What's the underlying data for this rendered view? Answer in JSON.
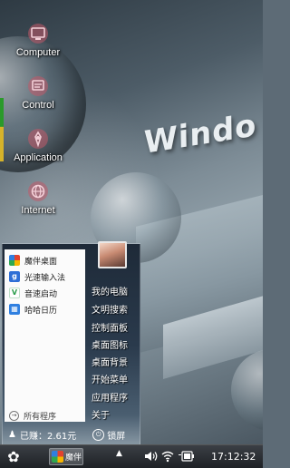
{
  "desktop": {
    "icons": [
      {
        "label": "Computer",
        "icon": "computer-icon"
      },
      {
        "label": "Control",
        "icon": "control-panel-icon"
      },
      {
        "label": "Application",
        "icon": "application-icon"
      },
      {
        "label": "Internet",
        "icon": "internet-icon"
      }
    ],
    "wallpaper_text": "Windo"
  },
  "start_menu": {
    "apps": [
      {
        "label": "魔伴桌面",
        "icon": "mobanzhuomian-app-icon",
        "color": "#3a8ee6"
      },
      {
        "label": "光速输入法",
        "icon": "guangsu-input-app-icon",
        "color": "#2e6fd6"
      },
      {
        "label": "音速启动",
        "icon": "yinsu-launch-app-icon",
        "color": "#2a9d4a"
      },
      {
        "label": "哈哈日历",
        "icon": "haha-calendar-app-icon",
        "color": "#2f7fe0"
      }
    ],
    "all_programs_label": "所有程序",
    "right_items": [
      {
        "label": "我的电脑"
      },
      {
        "label": "文明搜索"
      },
      {
        "label": "控制面板"
      },
      {
        "label": "桌面图标"
      },
      {
        "label": "桌面背景"
      },
      {
        "label": "开始菜单"
      },
      {
        "label": "应用程序"
      },
      {
        "label": "关于"
      }
    ],
    "earnings_label": "已赚：2.61元",
    "lock_label": "锁屏"
  },
  "taskbar": {
    "start_icon": "clover-start-icon",
    "task_label": "魔伴",
    "tray_up_arrow": "▲",
    "clock": "17:12:32"
  }
}
